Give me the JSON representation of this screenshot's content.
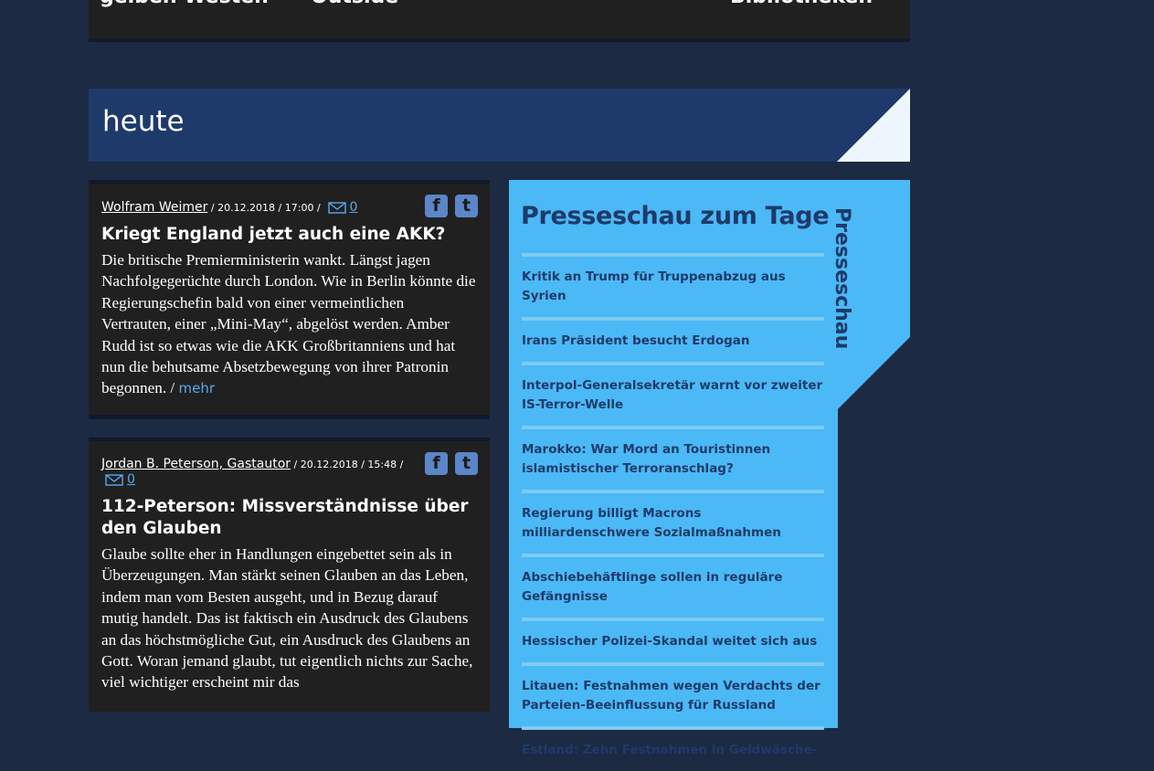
{
  "nav": {
    "items": [
      "gelben Westen",
      "Outside",
      "Bibliotheken"
    ]
  },
  "heute": {
    "title": "heute"
  },
  "articles": [
    {
      "author": "Wolfram Weimer",
      "date": " / 20.12.2018 / 17:00 /",
      "comments": "0",
      "headline": "Kriegt England jetzt auch eine AKK?",
      "teaser": "Die britische Premierministerin wankt. Längst jagen Nachfolgegerüchte durch London. Wie in Berlin könnte die Regierungschefin bald von einer vermeintlichen Vertrauten, einer „Mini-May“, abgelöst werden. Amber Rudd ist so etwas wie die AKK Großbritanniens und hat nun die behutsame Absetzbewegung von ihrer Patronin begonnen. / ",
      "more": "mehr"
    },
    {
      "author": "Jordan B. Peterson, Gastautor",
      "date": " / 20.12.2018 / 15:48 /",
      "comments": "0",
      "headline": "112-Peterson: Missverständnisse über den Glauben",
      "teaser": "Glaube sollte eher in Handlungen eingebettet sein als in Überzeugungen. Man stärkt seinen Glauben an das Leben, indem man vom Besten ausgeht, und in Bezug darauf mutig handelt. Das ist faktisch ein Ausdruck des Glaubens an das höchstmögliche Gut, ein Ausdruck des Glaubens an Gott. Woran jemand glaubt, tut eigentlich nichts zur Sache, viel wichtiger erscheint mir das"
    }
  ],
  "presseschau": {
    "title": "Presseschau zum Tage",
    "vertical_label": "Presseschau",
    "items": [
      "Kritik an Trump für Truppenabzug aus Syrien",
      "Irans Präsident besucht Erdogan",
      "Interpol-Generalsekretär warnt vor zweiter IS-Terror-Welle",
      "Marokko: War Mord an Touristinnen islamistischer Terroranschlag?",
      "Regierung billigt Macrons milliardenschwere Sozialmaßnahmen",
      "Abschiebehäftlinge sollen in reguläre Gefängnisse",
      "Hessischer Polizei-Skandal weitet sich aus",
      "Litauen: Festnahmen wegen Verdachts der Parteien-Beeinflussung für Russland",
      "Estland: Zehn Festnahmen in Geldwäsche-"
    ]
  },
  "colors": {
    "page_bg": "#1c2a43",
    "card_bg": "#202020",
    "banner_bg": "#1e3a6a",
    "presse_bg": "#4bb9f5",
    "link": "#5aa9f0",
    "share_icon": "#5b86c8"
  },
  "icons": {
    "share": [
      "facebook-icon",
      "twitter-icon"
    ],
    "comments": "mail-icon"
  }
}
